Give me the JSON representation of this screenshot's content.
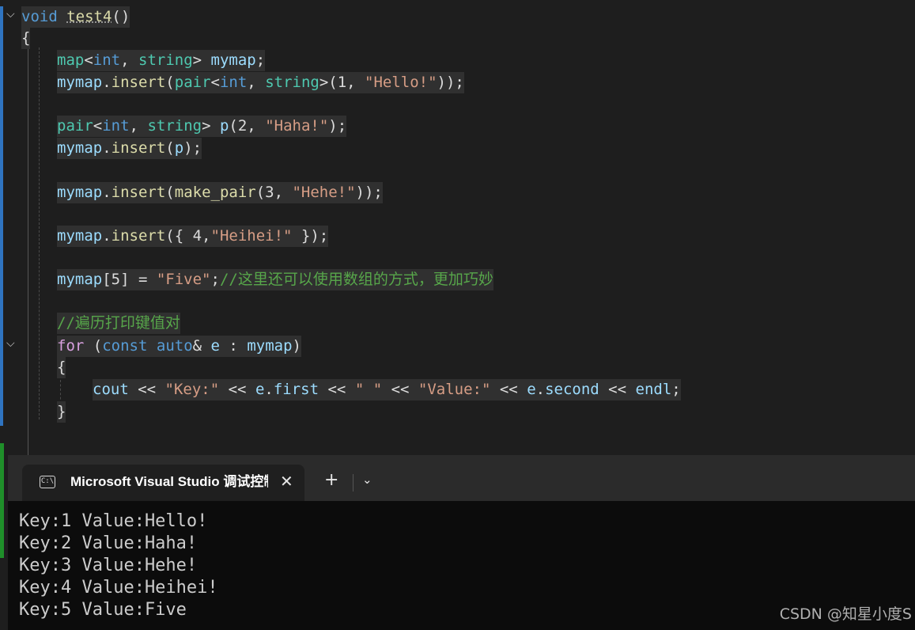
{
  "editor": {
    "lines": [
      [
        [
          "kw",
          "void"
        ],
        [
          "pl",
          " "
        ],
        [
          "fn squiggle",
          "test4"
        ],
        [
          "pl",
          "()"
        ]
      ],
      [
        [
          "pl",
          "{"
        ]
      ],
      [
        [
          "ty",
          "map"
        ],
        [
          "pl",
          "<"
        ],
        [
          "kw",
          "int"
        ],
        [
          "pl",
          ", "
        ],
        [
          "ty",
          "string"
        ],
        [
          "pl",
          "> "
        ],
        [
          "var",
          "mymap"
        ],
        [
          "pl",
          ";"
        ]
      ],
      [
        [
          "var",
          "mymap"
        ],
        [
          "pl",
          "."
        ],
        [
          "fn",
          "insert"
        ],
        [
          "pl",
          "("
        ],
        [
          "ty",
          "pair"
        ],
        [
          "pl",
          "<"
        ],
        [
          "kw",
          "int"
        ],
        [
          "pl",
          ", "
        ],
        [
          "ty",
          "string"
        ],
        [
          "pl",
          ">(1, "
        ],
        [
          "str",
          "\"Hello!\""
        ],
        [
          "pl",
          "));"
        ]
      ],
      [
        [
          "ty",
          "pair"
        ],
        [
          "pl",
          "<"
        ],
        [
          "kw",
          "int"
        ],
        [
          "pl",
          ", "
        ],
        [
          "ty",
          "string"
        ],
        [
          "pl",
          "> "
        ],
        [
          "var",
          "p"
        ],
        [
          "pl",
          "(2, "
        ],
        [
          "str",
          "\"Haha!\""
        ],
        [
          "pl",
          ");"
        ]
      ],
      [
        [
          "var",
          "mymap"
        ],
        [
          "pl",
          "."
        ],
        [
          "fn",
          "insert"
        ],
        [
          "pl",
          "("
        ],
        [
          "var",
          "p"
        ],
        [
          "pl",
          ");"
        ]
      ],
      [
        [
          "var",
          "mymap"
        ],
        [
          "pl",
          "."
        ],
        [
          "fn",
          "insert"
        ],
        [
          "pl",
          "("
        ],
        [
          "fn",
          "make_pair"
        ],
        [
          "pl",
          "(3, "
        ],
        [
          "str",
          "\"Hehe!\""
        ],
        [
          "pl",
          "));"
        ]
      ],
      [
        [
          "var",
          "mymap"
        ],
        [
          "pl",
          "."
        ],
        [
          "fn",
          "insert"
        ],
        [
          "pl",
          "({ 4,"
        ],
        [
          "str",
          "\"Heihei!\""
        ],
        [
          "pl",
          " });"
        ]
      ],
      [
        [
          "var",
          "mymap"
        ],
        [
          "pl",
          "[5] = "
        ],
        [
          "str",
          "\"Five\""
        ],
        [
          "pl",
          ";"
        ],
        [
          "cm",
          "//这里还可以使用数组的方式，更加巧妙"
        ]
      ],
      [
        [
          "cm",
          "//遍历打印键值对"
        ]
      ],
      [
        [
          "kw2",
          "for"
        ],
        [
          "pl",
          " ("
        ],
        [
          "kw",
          "const"
        ],
        [
          "pl",
          " "
        ],
        [
          "kw",
          "auto"
        ],
        [
          "pl",
          "& "
        ],
        [
          "var",
          "e"
        ],
        [
          "pl",
          " : "
        ],
        [
          "var",
          "mymap"
        ],
        [
          "pl",
          ")"
        ]
      ],
      [
        [
          "pl",
          "{"
        ]
      ],
      [
        [
          "var",
          "cout"
        ],
        [
          "pl",
          " << "
        ],
        [
          "str",
          "\"Key:\""
        ],
        [
          "pl",
          " << "
        ],
        [
          "var",
          "e"
        ],
        [
          "pl",
          "."
        ],
        [
          "var",
          "first"
        ],
        [
          "pl",
          " << "
        ],
        [
          "str",
          "\" \""
        ],
        [
          "pl",
          " << "
        ],
        [
          "str",
          "\"Value:\""
        ],
        [
          "pl",
          " << "
        ],
        [
          "var",
          "e"
        ],
        [
          "pl",
          "."
        ],
        [
          "var",
          "second"
        ],
        [
          "pl",
          " << "
        ],
        [
          "var",
          "endl"
        ],
        [
          "pl",
          ";"
        ]
      ],
      [
        [
          "pl",
          "}"
        ]
      ]
    ]
  },
  "terminal": {
    "tab_icon": "C:\\",
    "tab_title": "Microsoft Visual Studio 调试控制台",
    "close_glyph": "✕",
    "new_tab_glyph": "+",
    "dropdown_glyph": "⌄",
    "output": [
      "Key:1 Value:Hello!",
      "Key:2 Value:Haha!",
      "Key:3 Value:Hehe!",
      "Key:4 Value:Heihei!",
      "Key:5 Value:Five"
    ]
  },
  "watermark": "CSDN @知星小度S",
  "colors": {
    "keyword": "#569cd6",
    "control_keyword": "#d8a0df",
    "type": "#4ec9b0",
    "function": "#dcdcaa",
    "variable": "#9cdcfe",
    "string": "#d69d85",
    "comment": "#57a64a",
    "editor_bg": "#1e1e1e",
    "console_bg": "#0c0c0c"
  }
}
